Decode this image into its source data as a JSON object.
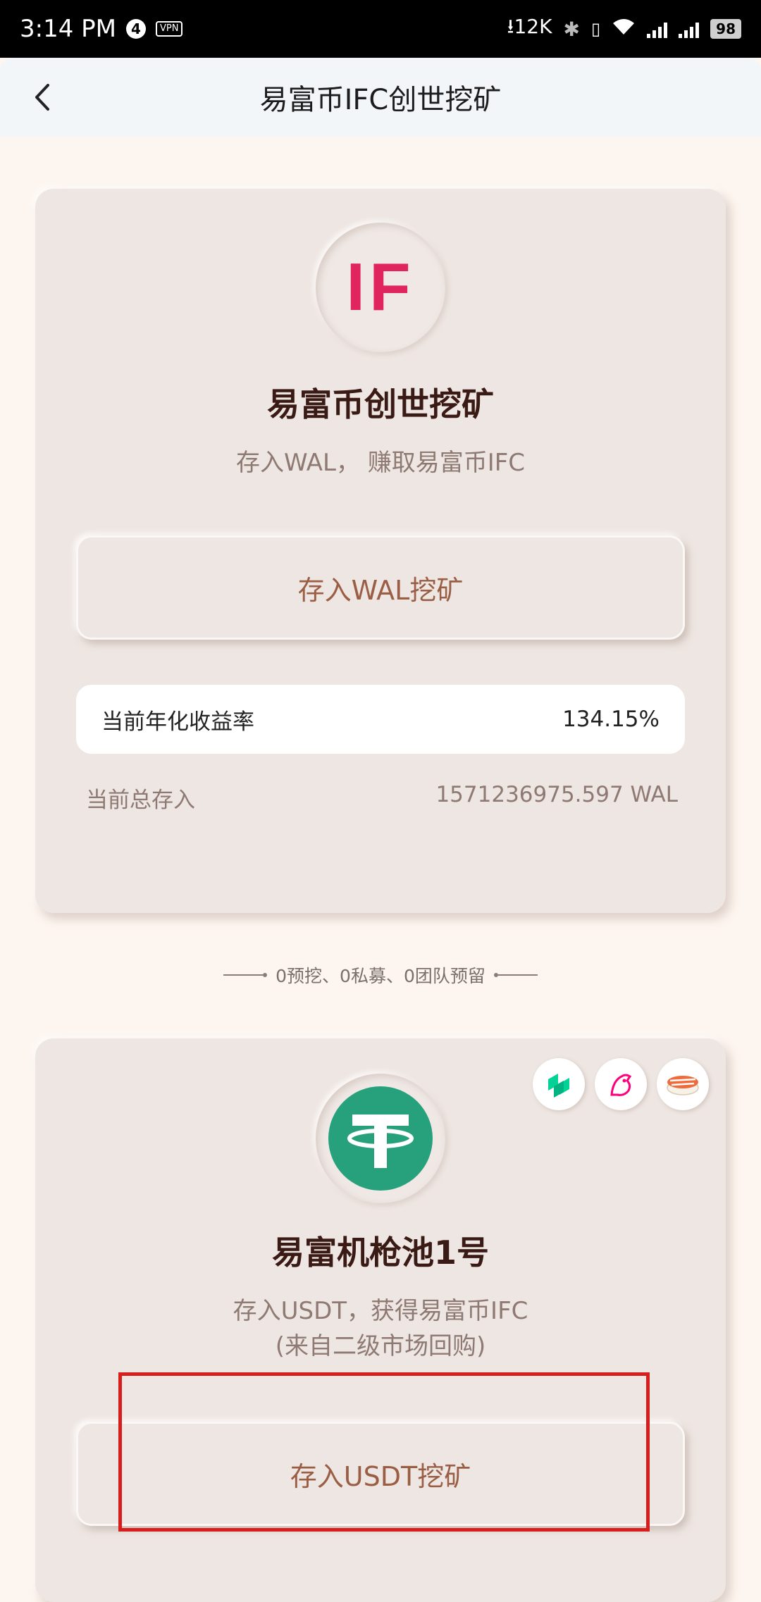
{
  "status_bar": {
    "time": "3:14 PM",
    "notif_count": "4",
    "vpn": "VPN",
    "speed": "12K",
    "battery": "98"
  },
  "nav": {
    "title": "易富币IFC创世挖矿"
  },
  "card1": {
    "logo_text": "IF",
    "title": "易富币创世挖矿",
    "subtitle": "存入WAL，  赚取易富币IFC",
    "button_label": "存入WAL挖矿",
    "rate_label": "当前年化收益率",
    "rate_value": "134.15%",
    "deposit_label": "当前总存入",
    "deposit_value": "1571236975.597 WAL"
  },
  "divider_text": "0预挖、0私募、0团队预留",
  "card2": {
    "title": "易富机枪池1号",
    "subtitle_line1": "存入USDT，获得易富币IFC",
    "subtitle_line2": "(来自二级市场回购)",
    "button_label": "存入USDT挖矿",
    "partners": [
      "compound-icon",
      "uniswap-icon",
      "sushiswap-icon"
    ]
  },
  "colors": {
    "accent_text": "#9a5e45",
    "logo_red": "#e0245e",
    "tether_green": "#26a17b",
    "highlight_red": "#d81d1d"
  }
}
